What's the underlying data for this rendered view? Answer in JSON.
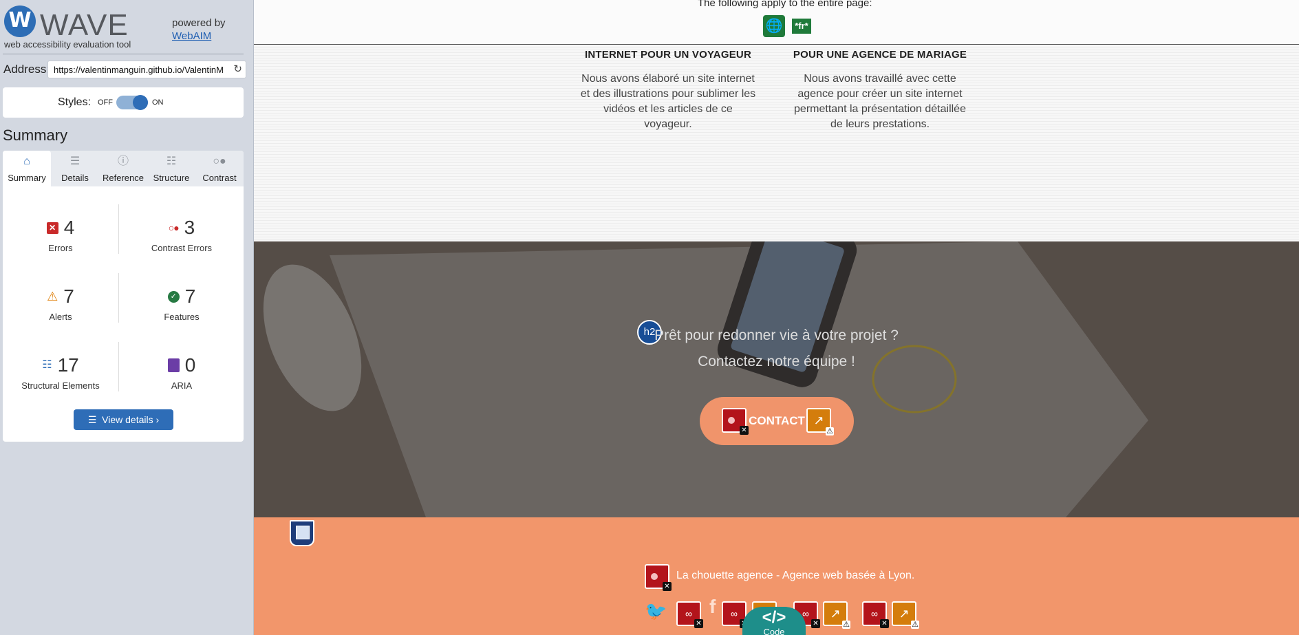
{
  "wave": {
    "logo_letter": "W",
    "logo_word": "WAVE",
    "tagline": "web accessibility evaluation tool",
    "powered_by": "powered by",
    "webaim_link": "WebAIM",
    "address_label": "Address:",
    "address_value": "https://valentinmanguin.github.io/ValentinM",
    "styles_label": "Styles:",
    "styles_off": "OFF",
    "styles_on": "ON",
    "summary_heading": "Summary",
    "tabs": [
      {
        "label": "Summary",
        "icon": "home-icon"
      },
      {
        "label": "Details",
        "icon": "list-icon"
      },
      {
        "label": "Reference",
        "icon": "info-icon"
      },
      {
        "label": "Structure",
        "icon": "hierarchy-icon"
      },
      {
        "label": "Contrast",
        "icon": "contrast-icon"
      }
    ],
    "stats": {
      "errors": {
        "count": "4",
        "label": "Errors"
      },
      "contrast_errors": {
        "count": "3",
        "label": "Contrast Errors"
      },
      "alerts": {
        "count": "7",
        "label": "Alerts"
      },
      "features": {
        "count": "7",
        "label": "Features"
      },
      "structural": {
        "count": "17",
        "label": "Structural Elements"
      },
      "aria": {
        "count": "0",
        "label": "ARIA"
      }
    },
    "view_details": "View details ›"
  },
  "page": {
    "top_notice": "The following apply to the entire page:",
    "lang_badge": "*fr*",
    "services": [
      {
        "title": "INTERNET POUR UN VOYAGEUR",
        "text": "Nous avons élaboré un site internet et des illustrations pour sublimer les vidéos et les articles de ce voyageur."
      },
      {
        "title": "POUR UNE AGENCE DE MARIAGE",
        "text": "Nous avons travaillé avec cette agence pour créer un site internet permettant la présentation détaillée de leurs prestations."
      }
    ],
    "hero": {
      "h2_badge": "h2",
      "line1": "Prêt pour redonner vie à votre projet ?",
      "line2": "Contactez notre équipe !",
      "contact_button": "CONTACT"
    },
    "footer": {
      "tagline": "La chouette agence - Agence web basée à Lyon."
    },
    "code_tab": {
      "glyph": "</>",
      "label": "Code"
    }
  },
  "colors": {
    "wave_blue": "#2e6db7",
    "error_red": "#b3141b",
    "alert_orange": "#d47d0c",
    "feature_green": "#1f7a3a",
    "footer_orange": "#f2966b",
    "button_orange": "#f0946b"
  }
}
